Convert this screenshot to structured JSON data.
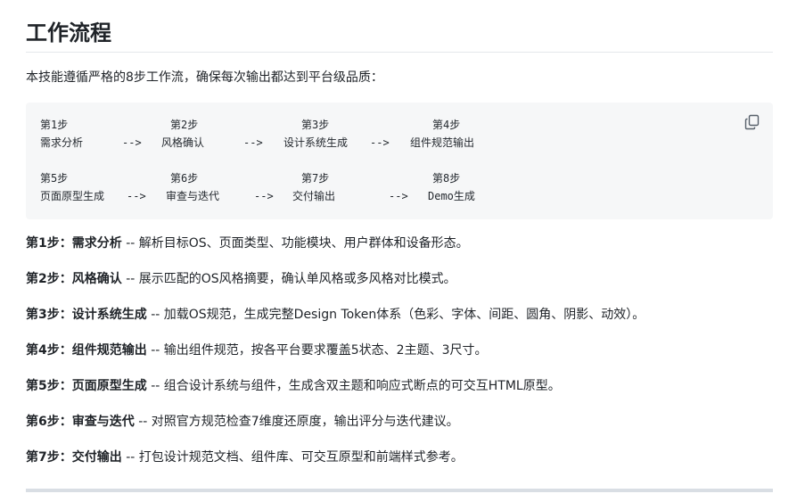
{
  "title": "工作流程",
  "intro": "本技能遵循严格的8步工作流，确保每次输出都达到平台级品质：",
  "code_block": {
    "row1": {
      "steps": [
        "第1步",
        "第2步",
        "第3步",
        "第4步"
      ],
      "names": [
        "需求分析",
        "风格确认",
        "设计系统生成",
        "组件规范输出"
      ],
      "arrows": [
        "-->",
        "-->",
        "-->"
      ]
    },
    "row2": {
      "steps": [
        "第5步",
        "第6步",
        "第7步",
        "第8步"
      ],
      "names": [
        "页面原型生成",
        "审查与迭代",
        "交付输出",
        "Demo生成"
      ],
      "arrows": [
        "-->",
        "-->",
        "-->"
      ]
    },
    "copy_icon": "copy-icon"
  },
  "steps": [
    {
      "label": "第1步：",
      "name": "需求分析",
      "desc": " -- 解析目标OS、页面类型、功能模块、用户群体和设备形态。"
    },
    {
      "label": "第2步：",
      "name": "风格确认",
      "desc": " -- 展示匹配的OS风格摘要，确认单风格或多风格对比模式。"
    },
    {
      "label": "第3步：",
      "name": "设计系统生成",
      "desc": " -- 加载OS规范，生成完整Design Token体系（色彩、字体、间距、圆角、阴影、动效）。"
    },
    {
      "label": "第4步：",
      "name": "组件规范输出",
      "desc": " -- 输出组件规范，按各平台要求覆盖5状态、2主题、3尺寸。"
    },
    {
      "label": "第5步：",
      "name": "页面原型生成",
      "desc": " -- 组合设计系统与组件，生成含双主题和响应式断点的可交互HTML原型。"
    },
    {
      "label": "第6步：",
      "name": "审查与迭代",
      "desc": " -- 对照官方规范检查7维度还原度，输出评分与迭代建议。"
    },
    {
      "label": "第7步：",
      "name": "交付输出",
      "desc": " -- 打包设计规范文档、组件库、可交互原型和前端样式参考。"
    }
  ]
}
